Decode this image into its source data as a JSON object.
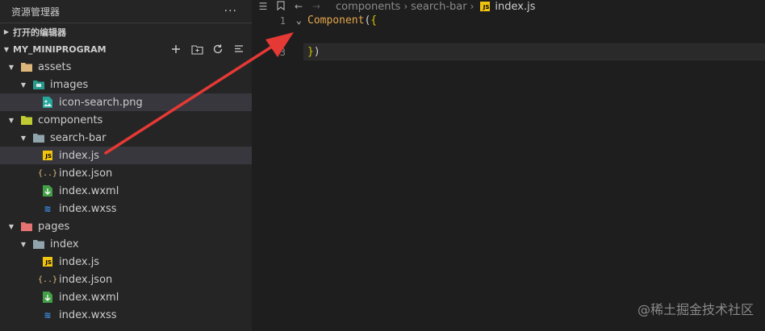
{
  "explorer": {
    "title": "资源管理器",
    "more": "···",
    "open_editors": "打开的编辑器",
    "project": "MY_MINIPROGRAM",
    "tree": [
      {
        "label": "assets",
        "depth": 0,
        "kind": "folder",
        "expanded": true,
        "icon": "assets-folder-icon"
      },
      {
        "label": "images",
        "depth": 1,
        "kind": "folder",
        "expanded": true,
        "icon": "images-folder-icon"
      },
      {
        "label": "icon-search.png",
        "depth": 2,
        "kind": "file",
        "icon": "image-file-icon",
        "highlight": true
      },
      {
        "label": "components",
        "depth": 0,
        "kind": "folder",
        "expanded": true,
        "icon": "components-folder-icon"
      },
      {
        "label": "search-bar",
        "depth": 1,
        "kind": "folder",
        "expanded": true,
        "icon": "folder-icon"
      },
      {
        "label": "index.js",
        "depth": 2,
        "kind": "file",
        "icon": "js-file-icon",
        "highlight": true
      },
      {
        "label": "index.json",
        "depth": 2,
        "kind": "file",
        "icon": "json-file-icon"
      },
      {
        "label": "index.wxml",
        "depth": 2,
        "kind": "file",
        "icon": "wxml-file-icon"
      },
      {
        "label": "index.wxss",
        "depth": 2,
        "kind": "file",
        "icon": "wxss-file-icon"
      },
      {
        "label": "pages",
        "depth": 0,
        "kind": "folder",
        "expanded": true,
        "icon": "pages-folder-icon"
      },
      {
        "label": "index",
        "depth": 1,
        "kind": "folder",
        "expanded": true,
        "icon": "folder-icon"
      },
      {
        "label": "index.js",
        "depth": 2,
        "kind": "file",
        "icon": "js-file-icon"
      },
      {
        "label": "index.json",
        "depth": 2,
        "kind": "file",
        "icon": "json-file-icon"
      },
      {
        "label": "index.wxml",
        "depth": 2,
        "kind": "file",
        "icon": "wxml-file-icon"
      },
      {
        "label": "index.wxss",
        "depth": 2,
        "kind": "file",
        "icon": "wxss-file-icon"
      }
    ]
  },
  "editor": {
    "breadcrumb": [
      "components",
      "search-bar",
      "index.js"
    ],
    "lines": [
      {
        "num": "1",
        "fold": true,
        "tokens": [
          {
            "t": "Component",
            "c": "kw"
          },
          {
            "t": "(",
            "c": "paren"
          },
          {
            "t": "{",
            "c": "brace"
          }
        ]
      },
      {
        "num": "",
        "fold": false,
        "tokens": []
      },
      {
        "num": "3",
        "fold": false,
        "tokens": [
          {
            "t": "}",
            "c": "brace"
          },
          {
            "t": ")",
            "c": "paren"
          }
        ]
      }
    ]
  },
  "watermark": "@稀土掘金技术社区",
  "colors": {
    "arrow": "#e53935",
    "js_badge": "#f1c40f",
    "folder": "#dcb67a",
    "css": "#3d8ee6",
    "selection": "#37373d"
  }
}
